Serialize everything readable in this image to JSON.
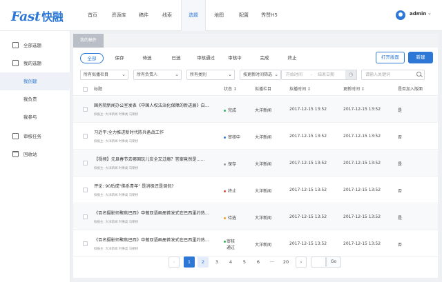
{
  "app": {
    "logo_text": "Fast",
    "logo_cn": "快融"
  },
  "nav": {
    "items": [
      {
        "label": "首页"
      },
      {
        "label": "资源库"
      },
      {
        "label": "稿件"
      },
      {
        "label": "线索"
      },
      {
        "label": "选题"
      },
      {
        "label": "地图"
      },
      {
        "label": "配置"
      },
      {
        "label": "秀赞H5"
      }
    ],
    "active_index": 4
  },
  "user": {
    "name": "admin",
    "caret": "⌄"
  },
  "sidebar": {
    "items": [
      {
        "label": "全部选题",
        "icon": "document-icon"
      },
      {
        "label": "我的选题",
        "icon": "my-topics-icon"
      },
      {
        "label": "我创建"
      },
      {
        "label": "我负责"
      },
      {
        "label": "我参与"
      },
      {
        "label": "审核任务",
        "icon": "review-icon"
      },
      {
        "label": "回收站",
        "icon": "trash-icon"
      }
    ]
  },
  "breadcrumb": {
    "label": "我的稿件"
  },
  "tabs": [
    {
      "label": "全部"
    },
    {
      "label": "保存"
    },
    {
      "label": "待选"
    },
    {
      "label": "已选"
    },
    {
      "label": "审核通过"
    },
    {
      "label": "审核中"
    },
    {
      "label": "完成"
    },
    {
      "label": "终止"
    }
  ],
  "actions": {
    "open_layout": "打开版面",
    "create": "新建"
  },
  "filters": {
    "column": "所有拟播栏目",
    "owner": "所有负责人",
    "type": "所有类别",
    "time_filter": "按更新时间筛选",
    "start_placeholder": "开始时间",
    "date_sep": "-",
    "end_placeholder": "结束日期",
    "search_placeholder": "请输入关键词"
  },
  "table": {
    "headers": {
      "title": "标题",
      "status": "状态 ↕",
      "column": "拟播栏目",
      "draft_time": "拟播时间 ↕",
      "update_time": "更新时间 ↕",
      "published": "是否加入版面"
    },
    "rows": [
      {
        "title": "国务院新闻办公室发表《中国人权法治化保障的新进展》白...",
        "meta": "拟报主: 大洋新闻        时事类        马朝桥",
        "status": "完成",
        "status_color": "#2fb560",
        "column": "大洋新闻",
        "draft_time": "2017-12-15  13:52",
        "update_time": "2017-12-15  13:52",
        "published": "是"
      },
      {
        "title": "习近平:全力推进新时代陈兵备战工作",
        "meta": "拟报主: 大洋新闻        时事类        马朝桥",
        "status": "审核中",
        "status_color": "#2d78d6",
        "column": "大洋新闻",
        "draft_time": "2017-12-15  13:52",
        "update_time": "2017-12-15  13:52",
        "published": "否"
      },
      {
        "title": "【视频】元旦春节去哪国玩儿安全又过瘾？答案竟然是......",
        "meta": "拟报主: 大洋新闻        时事类        马朝桥",
        "status": "保存",
        "status_color": "#999999",
        "column": "大洋新闻",
        "draft_time": "2017-12-15  13:52",
        "update_time": "2017-12-15  13:52",
        "published": "是"
      },
      {
        "title": "评论: 90后成\"佛系青年\" 是消极还是调侃?",
        "meta": "拟报主: 大洋新闻        时事类        马朝桥",
        "status": "终止",
        "status_color": "#e0463c",
        "column": "大洋新闻",
        "draft_time": "2017-12-15  13:52",
        "update_time": "2017-12-15  13:52",
        "published": "否"
      },
      {
        "title": "《百名摄影师聚焦巴西》中葡双语画册首发式在巴西里约热...",
        "meta": "拟报主: 大洋新闻        时事类        马朝桥",
        "status": "待选",
        "status_color": "#f0a020",
        "column": "大洋新闻",
        "draft_time": "2017-12-15  13:52",
        "update_time": "2017-12-15  13:52",
        "published": "是"
      },
      {
        "title": "《百名摄影师聚焦巴西》中葡双语画册首发式在巴西里约热...",
        "meta": "拟报主: 大洋新闻        时事类        马朝桥",
        "status": "审核\n通过",
        "status_color": "#2fb560",
        "column": "大洋新闻",
        "draft_time": "2017-12-15  13:52",
        "update_time": "2017-12-15  13:52",
        "published": "否"
      }
    ]
  },
  "pagination": {
    "prev": "‹",
    "pages": [
      "1",
      "2",
      "3",
      "4",
      "5",
      "6",
      "···",
      "20"
    ],
    "current": "1",
    "next": "›",
    "go_label": "Go"
  }
}
